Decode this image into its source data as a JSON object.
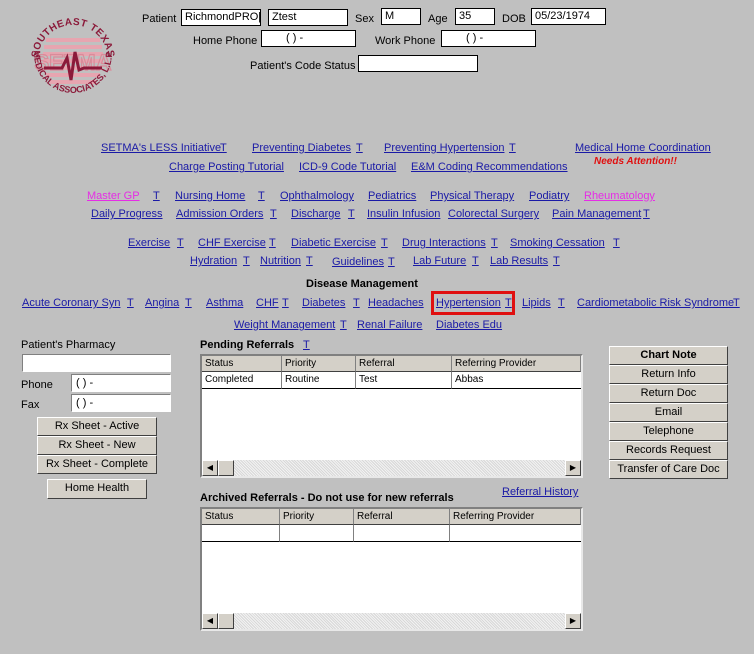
{
  "logo": {
    "top_text": "SOUTHEAST TEXAS",
    "mark": "SETMA",
    "bottom_text": "MEDICAL ASSOCIATES, L.L.P."
  },
  "patient": {
    "label": "Patient",
    "last_name": "RichmondPRO[",
    "first_name": "Ztest",
    "sex_label": "Sex",
    "sex": "M",
    "age_label": "Age",
    "age": "35",
    "dob_label": "DOB",
    "dob": "05/23/1974",
    "home_phone_label": "Home Phone",
    "home_phone": "(   )   -",
    "work_phone_label": "Work Phone",
    "work_phone": "(   )   -",
    "code_status_label": "Patient's Code Status",
    "code_status": ""
  },
  "links": {
    "row1": [
      {
        "label": "SETMA's LESS Initiative",
        "t": "T"
      },
      {
        "label": "Preventing Diabetes",
        "t": "T"
      },
      {
        "label": "Preventing Hypertension",
        "t": "T"
      },
      {
        "label": "Medical Home Coordination"
      }
    ],
    "needs_attention": "Needs Attention!!",
    "row2": [
      {
        "label": "Charge Posting Tutorial"
      },
      {
        "label": "ICD-9 Code Tutorial"
      },
      {
        "label": "E&M Coding Recommendations"
      }
    ],
    "row3": [
      {
        "label": "Master GP",
        "t": "T"
      },
      {
        "label": "Nursing Home",
        "t": "T"
      },
      {
        "label": "Ophthalmology"
      },
      {
        "label": "Pediatrics"
      },
      {
        "label": "Physical Therapy"
      },
      {
        "label": "Podiatry"
      },
      {
        "label": "Rheumatology"
      }
    ],
    "row4": [
      {
        "label": "Daily Progress"
      },
      {
        "label": "Admission Orders",
        "t": "T"
      },
      {
        "label": "Discharge",
        "t": "T"
      },
      {
        "label": "Insulin Infusion"
      },
      {
        "label": "Colorectal Surgery"
      },
      {
        "label": "Pain Management",
        "t": "T"
      }
    ],
    "row5": [
      {
        "label": "Exercise",
        "t": "T"
      },
      {
        "label": "CHF Exercise",
        "t": "T"
      },
      {
        "label": "Diabetic Exercise",
        "t": "T"
      },
      {
        "label": "Drug Interactions",
        "t": "T"
      },
      {
        "label": "Smoking Cessation",
        "t": "T"
      }
    ],
    "row6": [
      {
        "label": "Hydration",
        "t": "T"
      },
      {
        "label": "Nutrition",
        "t": "T"
      },
      {
        "label": "Guidelines",
        "t": "T"
      },
      {
        "label": "Lab Future",
        "t": "T"
      },
      {
        "label": "Lab Results",
        "t": "T"
      }
    ]
  },
  "disease_management": {
    "title": "Disease Management",
    "row1": [
      {
        "label": "Acute Coronary Syn",
        "t": "T"
      },
      {
        "label": "Angina",
        "t": "T"
      },
      {
        "label": "Asthma"
      },
      {
        "label": "CHF",
        "t": "T"
      },
      {
        "label": "Diabetes",
        "t": "T"
      },
      {
        "label": "Headaches"
      },
      {
        "label": "Hypertension",
        "t": "T",
        "highlighted": true
      },
      {
        "label": "Lipids",
        "t": "T"
      },
      {
        "label": "Cardiometabolic Risk Syndrome",
        "t": "T"
      }
    ],
    "row2": [
      {
        "label": "Weight Management",
        "t": "T"
      },
      {
        "label": "Renal Failure"
      },
      {
        "label": "Diabetes Edu"
      }
    ],
    "highlight_color": "#e01010"
  },
  "pharmacy": {
    "label": "Patient's Pharmacy",
    "value": "",
    "phone_label": "Phone",
    "phone": "(   )   -",
    "fax_label": "Fax",
    "fax": "(   )   -"
  },
  "rx_buttons": [
    "Rx Sheet - Active",
    "Rx Sheet - New",
    "Rx Sheet - Complete"
  ],
  "home_health": "Home Health",
  "pending": {
    "title": "Pending Referrals",
    "t": "T",
    "columns": [
      "Status",
      "Priority",
      "Referral",
      "Referring Provider"
    ],
    "rows": [
      [
        "Completed",
        "Routine",
        "Test",
        "Abbas"
      ]
    ]
  },
  "archived": {
    "title": "Archived Referrals - Do not use for new referrals",
    "history_link": "Referral History",
    "columns": [
      "Status",
      "Priority",
      "Referral",
      "Referring Provider"
    ],
    "rows": [
      [
        "",
        "",
        "",
        ""
      ]
    ]
  },
  "side_buttons": [
    "Chart Note",
    "Return Info",
    "Return Doc",
    "Email",
    "Telephone",
    "Records Request",
    "Transfer of Care Doc"
  ],
  "colors": {
    "link": "#1a1aa6",
    "pink_link": "#e52ee5",
    "alert": "#e01010",
    "background": "#c0c0c0",
    "logo": "#8b1a3a"
  }
}
